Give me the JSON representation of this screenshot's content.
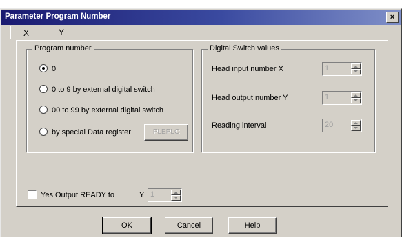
{
  "window": {
    "title": "Parameter Program Number",
    "close_glyph": "×"
  },
  "tabs": [
    {
      "label": "X"
    },
    {
      "label": "Y"
    }
  ],
  "program_group": {
    "legend": "Program number",
    "options": [
      {
        "label": "0",
        "checked": true
      },
      {
        "label": "0 to 9 by external digital switch",
        "checked": false
      },
      {
        "label": "00 to 99 by external digital switch",
        "checked": false
      },
      {
        "label": "by special Data register",
        "checked": false
      }
    ],
    "pleplc_button": "PLEPLC"
  },
  "digital_group": {
    "legend": "Digital Switch values",
    "fields": [
      {
        "label": "Head input number X",
        "value": "1"
      },
      {
        "label": "Head output number Y",
        "value": "1"
      },
      {
        "label": "Reading interval",
        "value": "20"
      }
    ]
  },
  "ready_output": {
    "label": "Yes Output READY to",
    "y_prefix": "Y",
    "value": "1",
    "checked": false
  },
  "buttons": {
    "ok": "OK",
    "cancel": "Cancel",
    "help": "Help"
  }
}
